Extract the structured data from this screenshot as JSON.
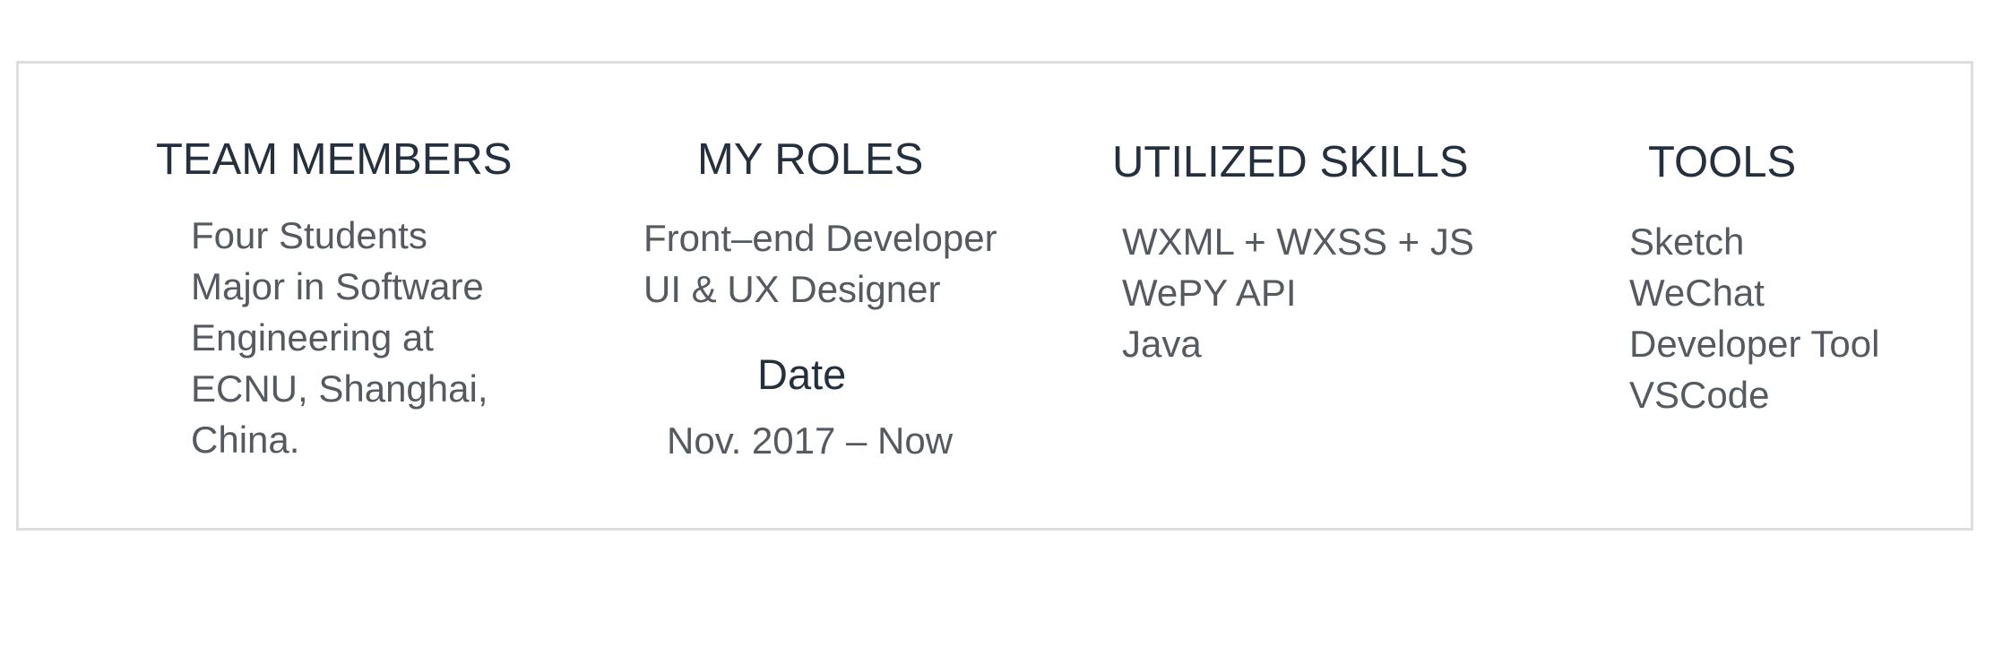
{
  "columns": {
    "team": {
      "heading": "TEAM MEMBERS",
      "lines": [
        "Four Students",
        "Major in Software",
        "Engineering at",
        "ECNU, Shanghai,",
        "China."
      ]
    },
    "roles": {
      "heading": "MY ROLES",
      "lines": [
        "Front–end Developer",
        "UI & UX Designer"
      ],
      "date_heading": "Date",
      "date_value": "Nov. 2017 – Now"
    },
    "skills": {
      "heading": "UTILIZED SKILLS",
      "lines": [
        "WXML + WXSS + JS",
        "WePY API",
        "Java"
      ]
    },
    "tools": {
      "heading": "TOOLS",
      "lines": [
        "Sketch",
        "WeChat",
        "Developer Tool",
        "VSCode"
      ]
    }
  },
  "colors": {
    "heading": "#25303e",
    "body_text": "#555a60",
    "panel_border": "#dedede"
  }
}
